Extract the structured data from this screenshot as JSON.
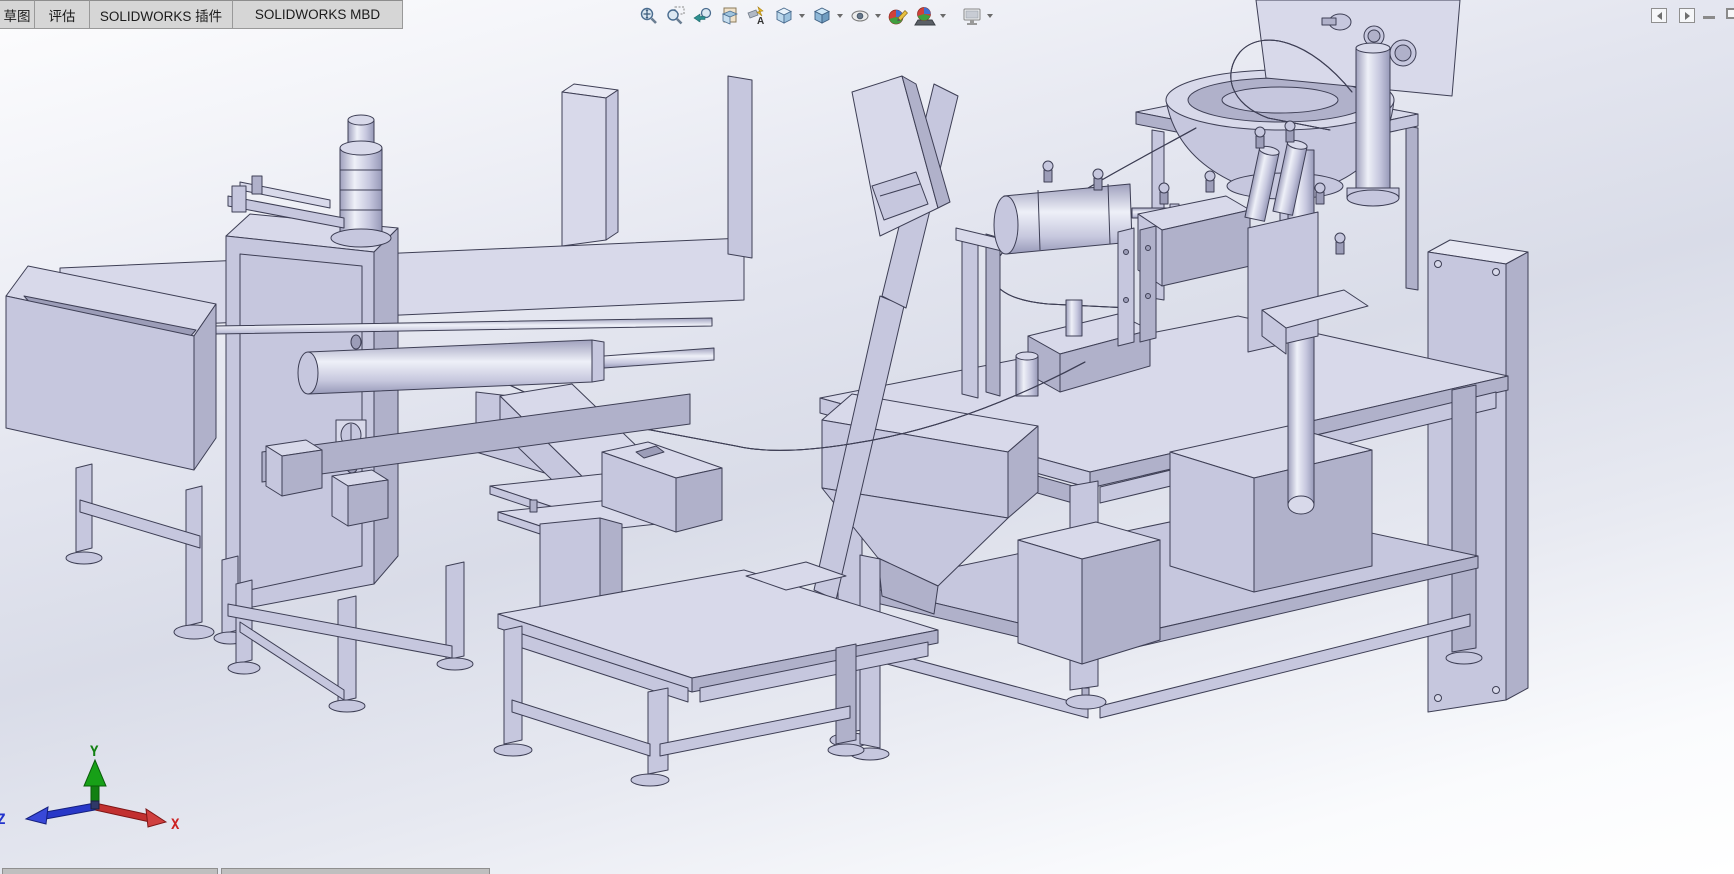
{
  "command_manager": {
    "tabs": [
      {
        "label": "草图"
      },
      {
        "label": "评估"
      },
      {
        "label": "SOLIDWORKS 插件"
      },
      {
        "label": "SOLIDWORKS MBD"
      }
    ]
  },
  "heads_up_toolbar": {
    "tools": [
      {
        "name": "zoom-to-fit",
        "dropdown": false
      },
      {
        "name": "zoom-to-area",
        "dropdown": false
      },
      {
        "name": "previous-view",
        "dropdown": false
      },
      {
        "name": "section-view",
        "dropdown": false
      },
      {
        "name": "dynamic-annotation-views",
        "dropdown": false
      },
      {
        "name": "view-orientation",
        "dropdown": true
      },
      {
        "name": "display-style",
        "dropdown": true
      },
      {
        "name": "hide-show-items",
        "dropdown": true
      },
      {
        "name": "edit-appearance",
        "dropdown": false
      },
      {
        "name": "apply-scene",
        "dropdown": true
      },
      {
        "name": "view-settings",
        "dropdown": true
      }
    ]
  },
  "window_controls": {
    "buttons": [
      {
        "name": "collapse-left"
      },
      {
        "name": "collapse-right"
      },
      {
        "name": "minimize"
      },
      {
        "name": "maximize"
      }
    ]
  },
  "viewport": {
    "triad": {
      "x_label": "X",
      "y_label": "Y",
      "z_label": "Z"
    },
    "axis_colors": {
      "x": "#cc2222",
      "y": "#128012",
      "z": "#2233cc"
    },
    "background_colors": {
      "top": "#fdfdfe",
      "middle": "#d9dce8",
      "bottom": "#ffffff"
    }
  },
  "model": {
    "type": "3D CAD assembly",
    "appearance": {
      "face_light": "#d8d9ea",
      "face_mid": "#c6c7de",
      "face_dark": "#b0b1ca",
      "face_darker": "#9c9db8",
      "edge": "#3e3f55"
    },
    "visible_components": [
      "parts bin",
      "feed conveyor with pneumatic cylinder",
      "control cabinet",
      "vertical cylinder stack",
      "parts chute on stand",
      "small control box",
      "center work table",
      "discharge funnel",
      "inclined board on strut",
      "feed rail track",
      "vibratory bowl feeder with control head",
      "curved return track",
      "assembly fixture cluster with pneumatic actuators",
      "main work table",
      "under-shelf storage boxes",
      "side panel",
      "leveling feet"
    ]
  },
  "status_bar": {
    "visible_segments": 2
  }
}
